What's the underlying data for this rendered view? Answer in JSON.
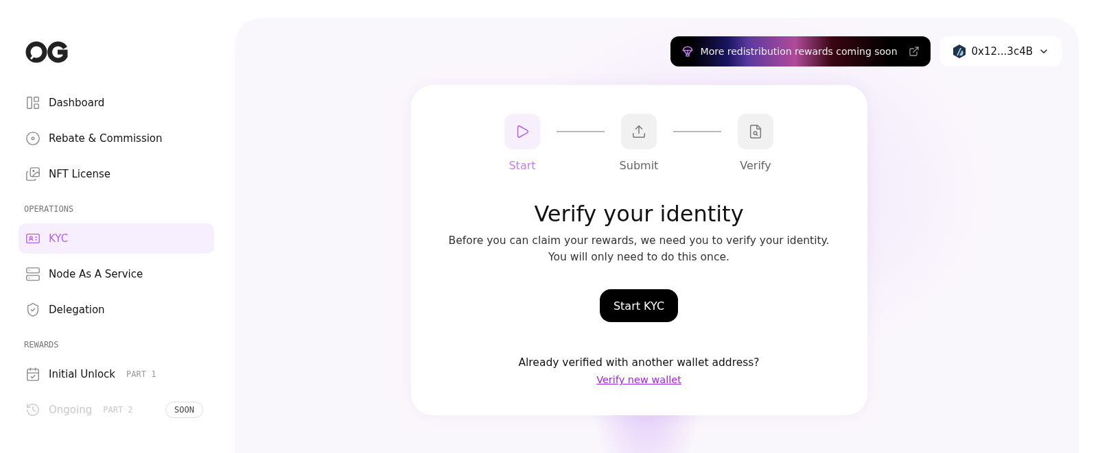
{
  "sidebar": {
    "sections": [
      {
        "items": [
          {
            "label": "Dashboard",
            "selected": false,
            "disabled": false
          },
          {
            "label": "Rebate & Commission",
            "selected": false,
            "disabled": false
          },
          {
            "label": "NFT License",
            "selected": false,
            "disabled": false
          }
        ]
      },
      {
        "title": "OPERATIONS",
        "items": [
          {
            "label": "KYC",
            "selected": true,
            "disabled": false
          },
          {
            "label": "Node As A Service",
            "selected": false,
            "disabled": false
          },
          {
            "label": "Delegation",
            "selected": false,
            "disabled": false
          }
        ]
      },
      {
        "title": "REWARDS",
        "items": [
          {
            "label": "Initial Unlock",
            "tag": "PART 1",
            "selected": false,
            "disabled": false
          },
          {
            "label": "Ongoing",
            "tag": "PART 2",
            "badge": "SOON",
            "selected": false,
            "disabled": true
          }
        ]
      }
    ]
  },
  "banner": {
    "text": "More redistribution rewards coming soon"
  },
  "wallet": {
    "address": "0x12...3c4B"
  },
  "steps": [
    {
      "label": "Start",
      "selected": true
    },
    {
      "label": "Submit",
      "selected": false
    },
    {
      "label": "Verify",
      "selected": false
    }
  ],
  "title": "Verify your identity",
  "description": [
    "Before you can claim your rewards, we need you to verify your identity.",
    "You will only need to do this once."
  ],
  "primary_button": "Start KYC",
  "question": "Already verified with another wallet address?",
  "link": "Verify new wallet"
}
